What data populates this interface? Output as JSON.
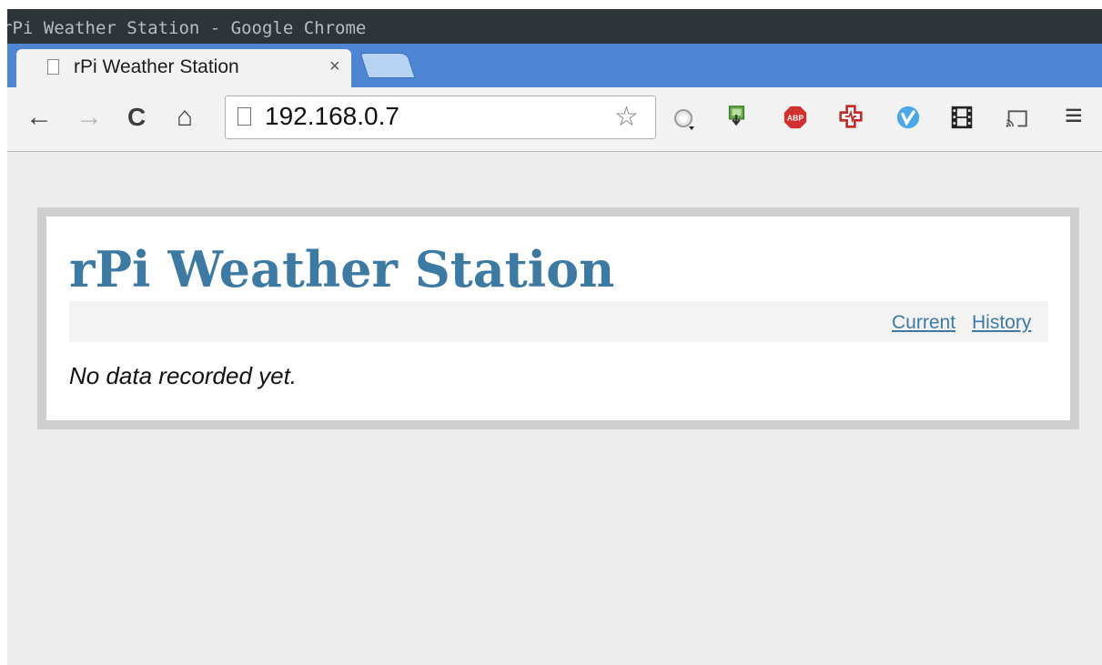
{
  "window": {
    "title": "rPi Weather Station - Google Chrome"
  },
  "tabs": [
    {
      "label": "rPi Weather Station",
      "close": "×"
    }
  ],
  "toolbar": {
    "back": "←",
    "forward": "→",
    "reload": "C",
    "home": "⌂",
    "url": "192.168.0.7",
    "bookmark_star": "☆",
    "extensions": [
      "search-extension-icon",
      "download-extension-icon",
      "adblock-plus-icon",
      "medic-extension-icon",
      "vimeo-extension-icon",
      "film-extension-icon",
      "cast-icon"
    ],
    "menu": "≡",
    "adblock_label": "ABP"
  },
  "page": {
    "title": "rPi Weather Station",
    "nav": [
      {
        "label": "Current"
      },
      {
        "label": "History"
      }
    ],
    "message": "No data recorded yet."
  },
  "colors": {
    "accent": "#3c7aa3",
    "tabstrip": "#4f86d3",
    "titlebar": "#2e3538",
    "page_bg": "#ececec",
    "card_border": "#cfcfcf"
  }
}
